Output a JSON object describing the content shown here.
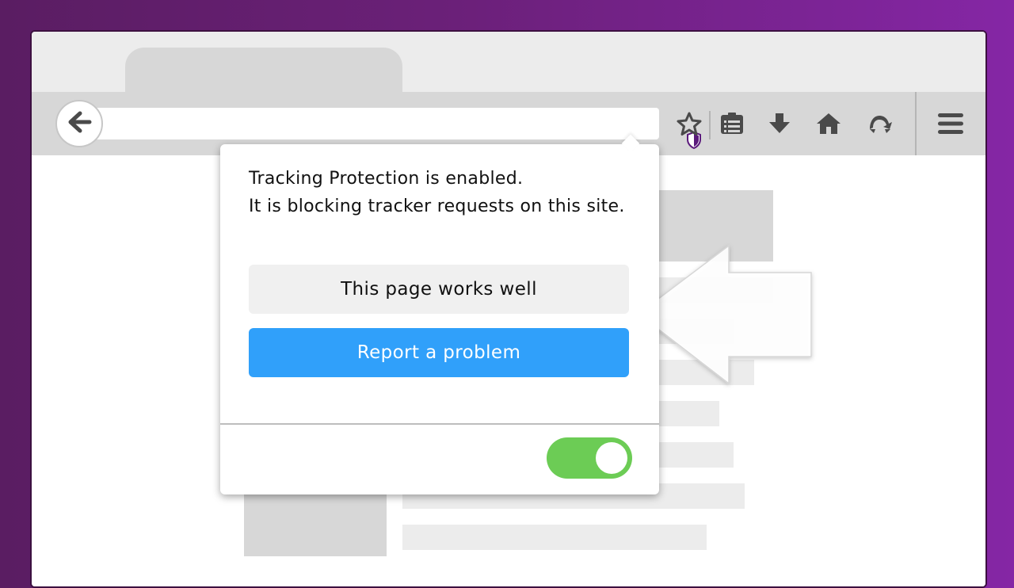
{
  "browser": {
    "tab_title": "",
    "url": ""
  },
  "popup": {
    "message_line1": "Tracking Protection is enabled.",
    "message_line2": "It is blocking tracker requests on this site.",
    "works_well_label": "This page works well",
    "report_label": "Report a problem",
    "toggle_state": "on"
  },
  "icons": {
    "back": "arrow-left-icon",
    "tracking": "shield-icon",
    "bookmark": "star-icon",
    "reading_list": "clipboard-list-icon",
    "downloads": "download-arrow-icon",
    "home": "home-icon",
    "sync": "sync-icon",
    "menu": "hamburger-menu-icon"
  },
  "colors": {
    "background_gradient": [
      "#5a1d62",
      "#8526a5"
    ],
    "report_button": "#30a0fa",
    "toggle_on": "#6ccc55",
    "shield": "#5b1a7c"
  }
}
